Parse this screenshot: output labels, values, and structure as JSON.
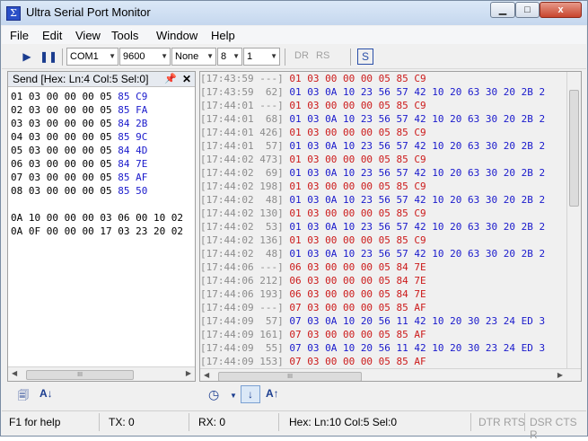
{
  "window": {
    "title": "Ultra Serial Port Monitor",
    "app_icon": "Σ",
    "close_glyph": "x"
  },
  "menu": [
    "File",
    "Edit",
    "View",
    "Tools",
    "Window",
    "Help"
  ],
  "toolbar": {
    "port": "COM1",
    "baud": "9600",
    "parity": "None",
    "databits": "8",
    "stopbits": "1",
    "dr_label": "DR",
    "rs_label": "RS",
    "s_label": "S"
  },
  "send_pane": {
    "header": "Send [Hex: Ln:4 Col:5 Sel:0]",
    "lines": [
      {
        "hex": "01 03 00 00 00 05 ",
        "crc": "85 C9"
      },
      {
        "hex": "02 03 00 00 00 05 ",
        "crc": "85 FA"
      },
      {
        "hex": "03 03 00 00 00 05 ",
        "crc": "84 2B"
      },
      {
        "hex": "04 03 00 00 00 05 ",
        "crc": "85 9C"
      },
      {
        "hex": "05 03 00 00 00 05 ",
        "crc": "84 4D"
      },
      {
        "hex": "06 03 00 00 00 05 ",
        "crc": "84 7E"
      },
      {
        "hex": "07 03 00 00 00 05 ",
        "crc": "85 AF"
      },
      {
        "hex": "08 03 00 00 00 05 ",
        "crc": "85 50"
      },
      {
        "hex": "",
        "crc": ""
      },
      {
        "hex": "0A 10 00 00 00 03 06 00 10 02",
        "crc": ""
      },
      {
        "hex": "0A 0F 00 00 00 17 03 23 20 02",
        "crc": ""
      }
    ]
  },
  "log": [
    {
      "dir": "tx",
      "ts": "[17:43:59 ---] ",
      "data": "01 03 00 00 00 05 85 C9"
    },
    {
      "dir": "rx",
      "ts": "[17:43:59  62] ",
      "data": "01 03 0A 10 23 56 57 42 10 20 63 30 20 2B 2"
    },
    {
      "dir": "tx",
      "ts": "[17:44:01 ---] ",
      "data": "01 03 00 00 00 05 85 C9"
    },
    {
      "dir": "rx",
      "ts": "[17:44:01  68] ",
      "data": "01 03 0A 10 23 56 57 42 10 20 63 30 20 2B 2"
    },
    {
      "dir": "tx",
      "ts": "[17:44:01 426] ",
      "data": "01 03 00 00 00 05 85 C9"
    },
    {
      "dir": "rx",
      "ts": "[17:44:01  57] ",
      "data": "01 03 0A 10 23 56 57 42 10 20 63 30 20 2B 2"
    },
    {
      "dir": "tx",
      "ts": "[17:44:02 473] ",
      "data": "01 03 00 00 00 05 85 C9"
    },
    {
      "dir": "rx",
      "ts": "[17:44:02  69] ",
      "data": "01 03 0A 10 23 56 57 42 10 20 63 30 20 2B 2"
    },
    {
      "dir": "tx",
      "ts": "[17:44:02 198] ",
      "data": "01 03 00 00 00 05 85 C9"
    },
    {
      "dir": "rx",
      "ts": "[17:44:02  48] ",
      "data": "01 03 0A 10 23 56 57 42 10 20 63 30 20 2B 2"
    },
    {
      "dir": "tx",
      "ts": "[17:44:02 130] ",
      "data": "01 03 00 00 00 05 85 C9"
    },
    {
      "dir": "rx",
      "ts": "[17:44:02  53] ",
      "data": "01 03 0A 10 23 56 57 42 10 20 63 30 20 2B 2"
    },
    {
      "dir": "tx",
      "ts": "[17:44:02 136] ",
      "data": "01 03 00 00 00 05 85 C9"
    },
    {
      "dir": "rx",
      "ts": "[17:44:02  48] ",
      "data": "01 03 0A 10 23 56 57 42 10 20 63 30 20 2B 2"
    },
    {
      "dir": "tx",
      "ts": "[17:44:06 ---] ",
      "data": "06 03 00 00 00 05 84 7E"
    },
    {
      "dir": "tx",
      "ts": "[17:44:06 212] ",
      "data": "06 03 00 00 00 05 84 7E"
    },
    {
      "dir": "tx",
      "ts": "[17:44:06 193] ",
      "data": "06 03 00 00 00 05 84 7E"
    },
    {
      "dir": "tx",
      "ts": "[17:44:09 ---] ",
      "data": "07 03 00 00 00 05 85 AF"
    },
    {
      "dir": "rx",
      "ts": "[17:44:09  57] ",
      "data": "07 03 0A 10 20 56 11 42 10 20 30 23 24 ED 3"
    },
    {
      "dir": "tx",
      "ts": "[17:44:09 161] ",
      "data": "07 03 00 00 00 05 85 AF"
    },
    {
      "dir": "rx",
      "ts": "[17:44:09  55] ",
      "data": "07 03 0A 10 20 56 11 42 10 20 30 23 24 ED 3"
    },
    {
      "dir": "tx",
      "ts": "[17:44:09 153] ",
      "data": "07 03 00 00 00 05 85 AF"
    }
  ],
  "status": {
    "help": "F1 for help",
    "tx": "TX: 0",
    "rx": "RX: 0",
    "hex": "Hex: Ln:10  Col:5  Sel:0",
    "dtr_rts": "DTR RTS",
    "dsr_cts": "DSR CTS R"
  },
  "colors": {
    "tx": "#cc1a1a",
    "rx": "#1a1acc",
    "timestamp": "#8c8c8c"
  }
}
